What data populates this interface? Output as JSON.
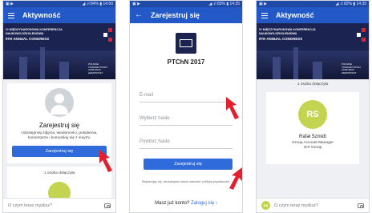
{
  "screen1": {
    "status": {
      "left": "▣ ▶",
      "right": "◢ .ıl 84% ▮ 14:00"
    },
    "appbar": {
      "title": "Aktywność"
    },
    "banner": {
      "line1": "VI MIĘDZYNARODOWA KONFERENCJA",
      "line2": "NAUKOWO-SZKOLENIOWA",
      "line3": "9TH ANNUAL CONGRESS",
      "tag": "POLSKIE TOWARZYSTWO CHIRURGII HEMOSTAZY"
    },
    "signup_card": {
      "title": "Zarejestruj się",
      "subtitle": "Udostępniaj zdjęcia, wiadomości, polubienia, komentarze i komunikuj się z innymi.",
      "button": "Zarejestruj się"
    },
    "joined_count": "1 osoba dołączyła",
    "composer": {
      "placeholder": "O czym teraz myślisz?"
    }
  },
  "screen2": {
    "status": {
      "left": "▣ ▶",
      "right": "◢ .ıl 83% ▮ 14:35"
    },
    "appbar": {
      "title": "Zarejestruj się"
    },
    "event_name": "PTChN 2017",
    "fields": {
      "email": "E-mail",
      "password": "Wybierz hasło",
      "repeat": "Powtórz hasło"
    },
    "button": "Zarejestruj się",
    "terms": "Rejestrując się, akceptujesz nasze warunki i politykę prywatności.",
    "login_prompt": "Masz już konto?",
    "login_link": "Zaloguj się ›"
  },
  "screen3": {
    "status": {
      "left": "▣ ▶",
      "right": "◢ .ıl 82% ▮ 14:35"
    },
    "appbar": {
      "title": "Aktywność"
    },
    "banner": {
      "line1": "VI MIĘDZYNARODOWA KONFERENCJA",
      "line2": "NAUKOWO-SZKOLENIOWA",
      "line3": "9TH ANNUAL CONGRESS",
      "tag": "POLSKIE TOWARZYSTWO CHIRURGII HEMOSTAZY"
    },
    "joined_count": "1 osoba dołączyła",
    "member": {
      "initials": "RS",
      "name": "Rafał Szmidt",
      "role": "Group Account Manager",
      "company": "ICP Group"
    },
    "composer": {
      "initials": "RS",
      "placeholder": "O czym teraz myślisz?"
    }
  },
  "colors": {
    "primary": "#2358c7",
    "button": "#2f6bdb",
    "avatar_green": "#c3d451",
    "arrow_red": "#e5202e"
  }
}
